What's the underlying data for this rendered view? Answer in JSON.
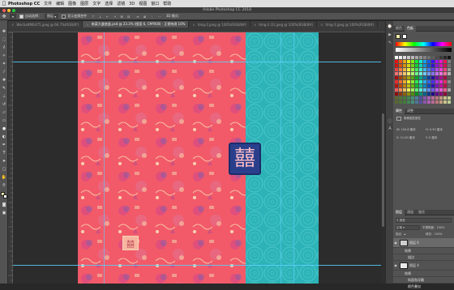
{
  "menubar": {
    "apple": "",
    "app": "Photoshop CC",
    "items": [
      "文件",
      "编辑",
      "图像",
      "图层",
      "文字",
      "选择",
      "滤镜",
      "3D",
      "视图",
      "窗口",
      "帮助"
    ]
  },
  "window": {
    "title": "Adobe Photoshop CC 2018"
  },
  "options_bar": {
    "auto_select_label": "自动选择：",
    "auto_select_value": "图层",
    "transform_label": "显示变换控件",
    "mode_label": "3D 模式："
  },
  "tabs": [
    {
      "label": "WechatIMG475.jpeg @ 66.7%(RGB/8*)",
      "active": false
    },
    {
      "label": "新菜大盒底盖.psd @ 23.3% (图案 6, CMYK/8) · 正视待测 10%",
      "active": true
    },
    {
      "label": "timg-2.jpeg @ 100%(RGB/8#)",
      "active": false
    },
    {
      "label": "timg-2 (2).jpeg @ 100%(RGB/8#)",
      "active": false
    },
    {
      "label": "timg-3.jpeg @ 100%(RGB/8#)",
      "active": false
    }
  ],
  "panels": {
    "color_tabs": [
      "颜色",
      "色板"
    ],
    "properties_tabs": [
      "属性",
      "调整"
    ],
    "properties_title": "像素图层属性",
    "prop_w_label": "W:",
    "prop_w": "104.8 厘米",
    "prop_h_label": "H:",
    "prop_h": "0.50 厘米",
    "prop_x_label": "X:",
    "prop_x": "11.00 厘米",
    "prop_y_label": "Y:",
    "prop_y": "0 厘米",
    "layers_tabs": [
      "图层",
      "通道",
      "路径"
    ],
    "kind_label": "类型",
    "blend_label": "正常",
    "opacity_label": "不透明度：",
    "opacity": "100%",
    "lock_label": "锁定：",
    "fill_label": "填充：",
    "fill": "100%",
    "layers": [
      {
        "name": "图层 6",
        "selected": true
      },
      {
        "name": "效果",
        "selected": false
      },
      {
        "name": "描边",
        "selected": false
      },
      {
        "name": "图层 4",
        "selected": false
      },
      {
        "name": "效果",
        "selected": false
      },
      {
        "name": "斜面和浮雕",
        "selected": false
      },
      {
        "name": "颜色叠加",
        "selected": false
      }
    ]
  },
  "colors": {
    "red_pattern": "#f25a69",
    "teal_pattern": "#2db3b7",
    "seal_blue": "#2a3f8c",
    "guide": "#5ad0ff"
  },
  "icons": [
    "apple-icon",
    "move-tool-icon",
    "marquee-tool-icon",
    "lasso-tool-icon",
    "magic-wand-icon",
    "crop-tool-icon",
    "eyedropper-icon",
    "healing-brush-icon",
    "brush-tool-icon",
    "stamp-tool-icon",
    "history-brush-icon",
    "eraser-icon",
    "gradient-tool-icon",
    "blur-tool-icon",
    "dodge-tool-icon",
    "pen-tool-icon",
    "type-tool-icon",
    "path-select-icon",
    "shape-tool-icon",
    "hand-tool-icon",
    "zoom-tool-icon",
    "eye-icon"
  ]
}
